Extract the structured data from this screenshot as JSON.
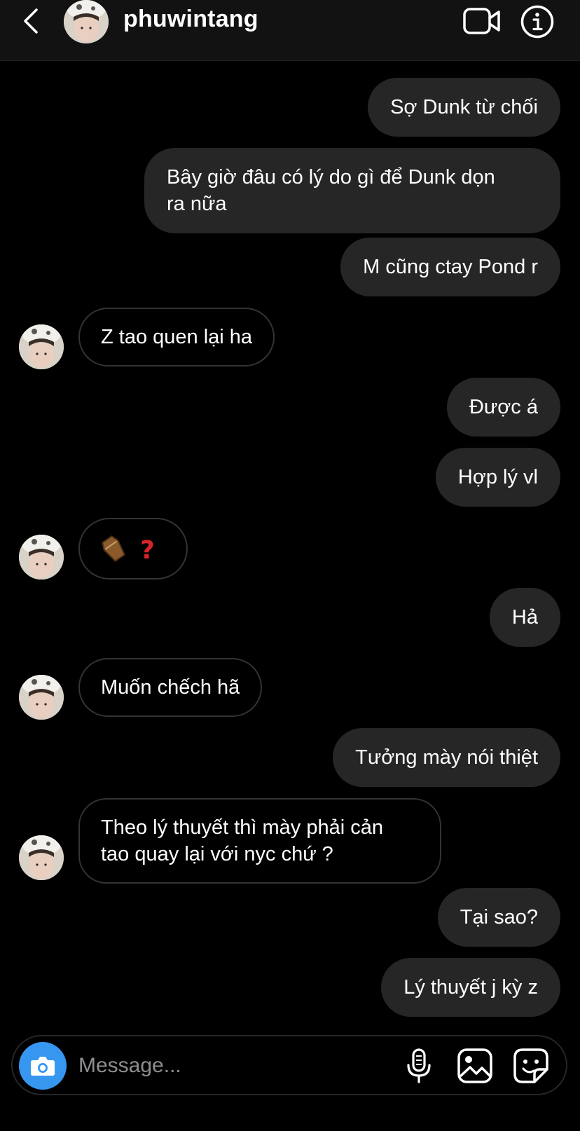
{
  "header": {
    "username": "phuwintang",
    "icons": [
      "back-chevron-icon",
      "video-call-icon",
      "info-icon"
    ]
  },
  "messages": [
    {
      "from": "me",
      "text": "Sợ Dunk từ chối"
    },
    {
      "from": "me",
      "text": "Bây giờ đâu có lý do gì để Dunk dọn\nra nữa"
    },
    {
      "from": "me",
      "text": "M cũng ctay Pond r"
    },
    {
      "from": "them",
      "text": "Z tao quen lại ha"
    },
    {
      "from": "me",
      "text": "Được á"
    },
    {
      "from": "me",
      "text": "Hợp lý vl"
    },
    {
      "from": "them",
      "text": "⚰️ ❓"
    },
    {
      "from": "me",
      "text": "Hả"
    },
    {
      "from": "them",
      "text": "Muốn chếch hã"
    },
    {
      "from": "me",
      "text": "Tưởng mày nói thiệt"
    },
    {
      "from": "them",
      "text": "Theo lý thuyết thì mày phải cản\ntao quay lại với nyc chứ ?"
    },
    {
      "from": "me",
      "text": "Tại sao?"
    },
    {
      "from": "me",
      "text": "Lý thuyết j kỳ z"
    }
  ],
  "composer": {
    "placeholder": "Message...",
    "accent_color": "#3797f0",
    "icons": [
      "camera-icon",
      "microphone-icon",
      "gallery-icon",
      "sticker-icon"
    ]
  },
  "colors": {
    "background": "#000000",
    "outgoing_bubble": "#262626",
    "incoming_border": "#333333"
  }
}
